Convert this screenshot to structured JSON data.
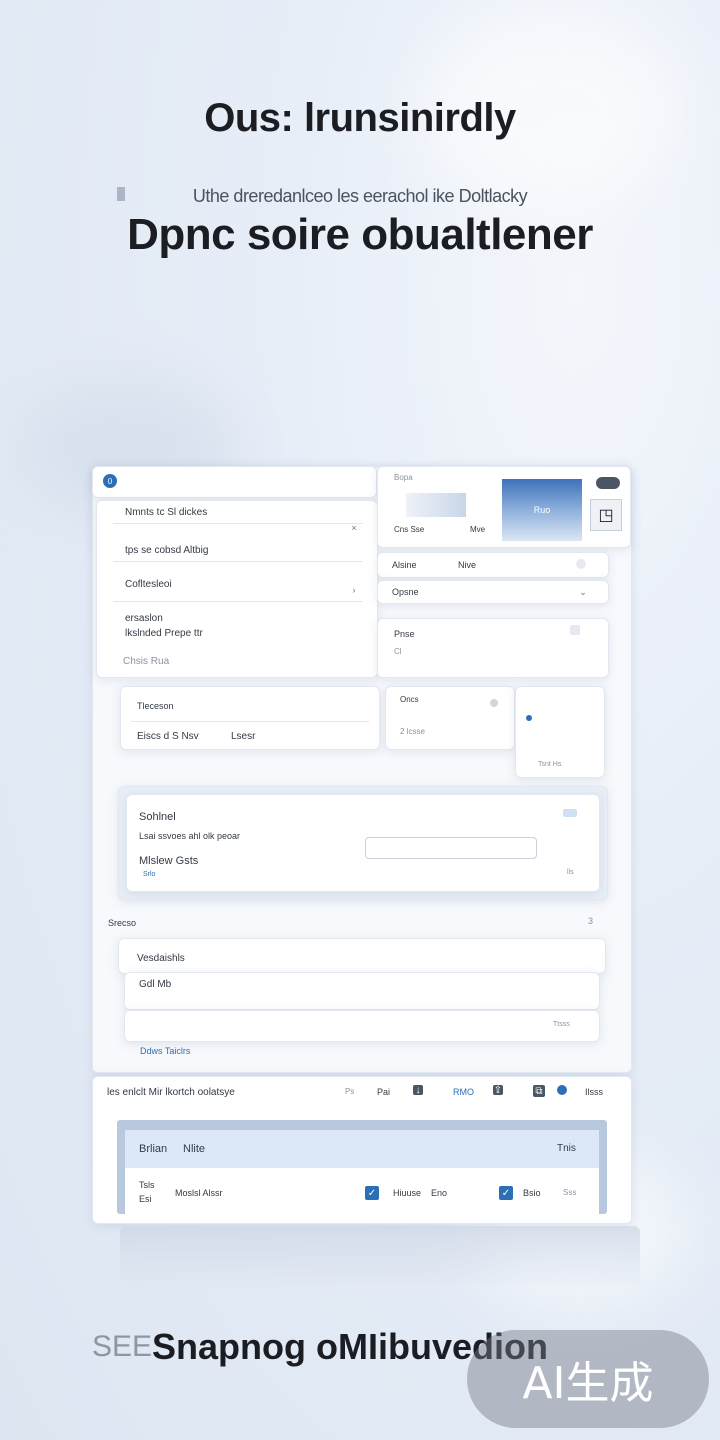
{
  "hero": {
    "title": "Ous: lrunsinirdly",
    "subtitle_small": "Uthe dreredanlceo les eerachol ike Doltlacky",
    "subtitle_large": "Dpnc soire obualtlener"
  },
  "top_left": {
    "header_label": "0",
    "row1": "Nmnts tc Sl dickes",
    "row2": "tps se cobsd Altbig",
    "row3": "Cofltesleoi",
    "row4a": "ersaslon",
    "row4b": "lkslnded Prepe ttr",
    "row5": "Chsis Rua"
  },
  "top_right": {
    "header_label": "Bopa",
    "image_label": "Ruo",
    "caption_left": "Cns Sse",
    "caption_right": "Mve",
    "row1_label": "Alsine",
    "row1_value": "Nive",
    "row2_label": "Opsne",
    "card_label": "Pnse",
    "card_sub": "Cl",
    "card2_label": "Oncs",
    "card2_row": "2 lcsse",
    "footnote": "Tsnt Hs"
  },
  "left_mid": {
    "label": "Tleceson",
    "row": "Eiscs d S Nsv",
    "row_suffix": "Lsesr"
  },
  "form": {
    "title": "Sohlnel",
    "desc": "Lsai ssvoes ahl olk peoar",
    "field_label": "Mlslew Gsts",
    "link": "Srlo",
    "field_placeholder": "",
    "corner": "lls"
  },
  "section2": {
    "label": "Srecso",
    "item_title": "Vesdaishls",
    "item_sub": "Gdl Mb",
    "footer_link": "Ddws Taiclrs",
    "count": "3",
    "right_note": "Ttsss"
  },
  "toolbar": {
    "title": "les enlclt Mir lkortch oolatsye",
    "item1": "Ps",
    "item2": "Pai",
    "item3": "lsss",
    "item4": "RMO",
    "last": "Ilsss"
  },
  "table": {
    "head_left": "Brlian",
    "head_mid": "Nlite",
    "head_right": "Tnis",
    "row_col1a": "Tsls",
    "row_col1b": "Esi",
    "row_col2": "Moslsl Alssr",
    "row_col3": "Hiuuse",
    "row_col4": "Eno",
    "row_col5": "Bsio",
    "row_col6": "Sss"
  },
  "footer": {
    "prefix": "SEE",
    "tagline": "Snapnog oMIibuvedion"
  },
  "watermark": "AI生成",
  "colors": {
    "accent": "#2c6fb6",
    "panel_border": "#e3e8f0",
    "header_blue": "#dce8f8"
  }
}
